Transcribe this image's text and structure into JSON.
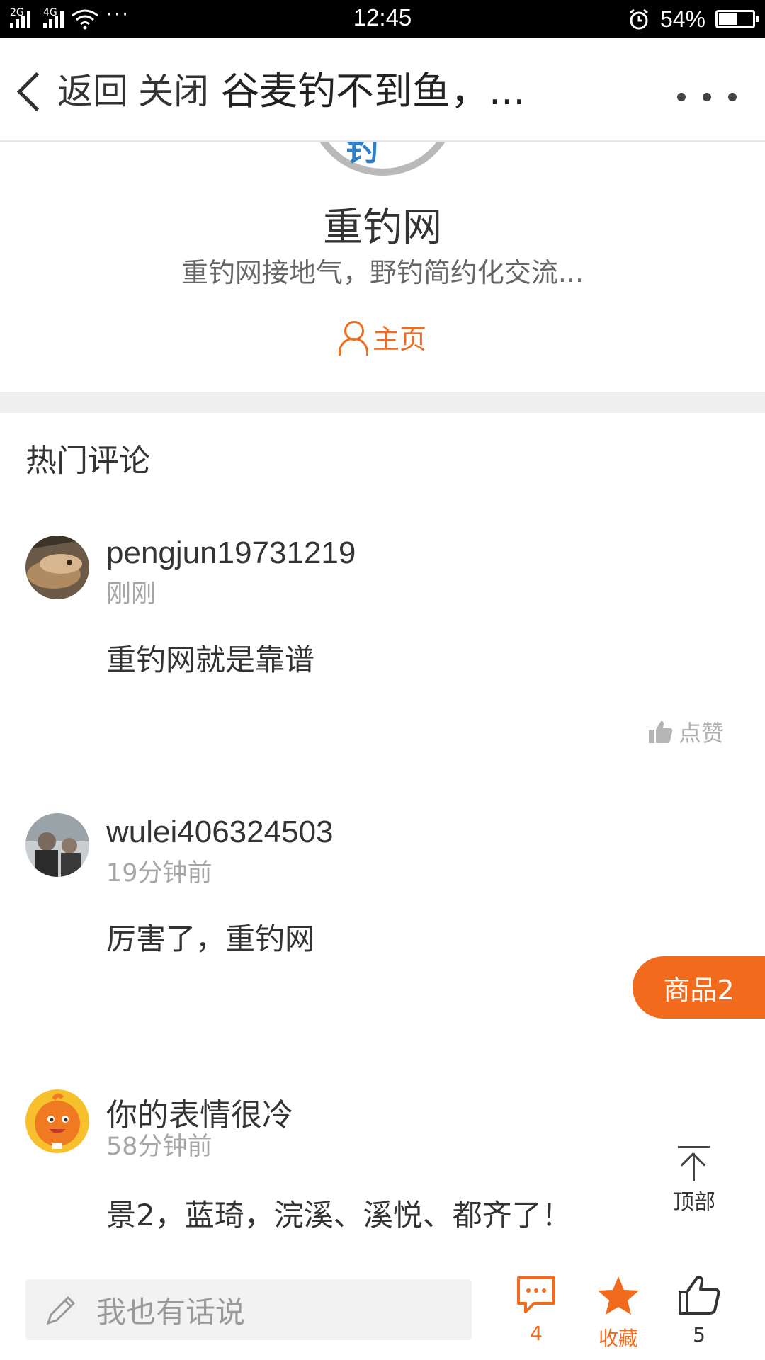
{
  "status_bar": {
    "net1": "2G",
    "net2": "4G",
    "dots": "···",
    "time": "12:45",
    "battery": "54%",
    "battery_level": 0.54
  },
  "nav": {
    "back_label": "返回",
    "close_label": "关闭",
    "title": "谷麦钓不到鱼，..."
  },
  "author": {
    "logo_text": "钓",
    "name": "重钓网",
    "desc": "重钓网接地气，野钓简约化交流...",
    "home_label": "主页"
  },
  "section_title": "热门评论",
  "comments": [
    {
      "user": "pengjun19731219",
      "time": "刚刚",
      "text": "重钓网就是靠谱"
    },
    {
      "user": "wulei406324503",
      "time": "19分钟前",
      "text": "厉害了，重钓网"
    },
    {
      "user": "你的表情很冷",
      "time": "58分钟前",
      "text": "景2，蓝琦，浣溪、溪悦、都齐了！"
    }
  ],
  "like_label": "点赞",
  "goods_button": "商品2",
  "top_button": "顶部",
  "bottom": {
    "reply_placeholder": "我也有话说",
    "comment_count": "4",
    "favorite_label": "收藏",
    "like_count": "5"
  },
  "colors": {
    "accent": "#f26a1b",
    "muted": "#a6a6a6"
  }
}
